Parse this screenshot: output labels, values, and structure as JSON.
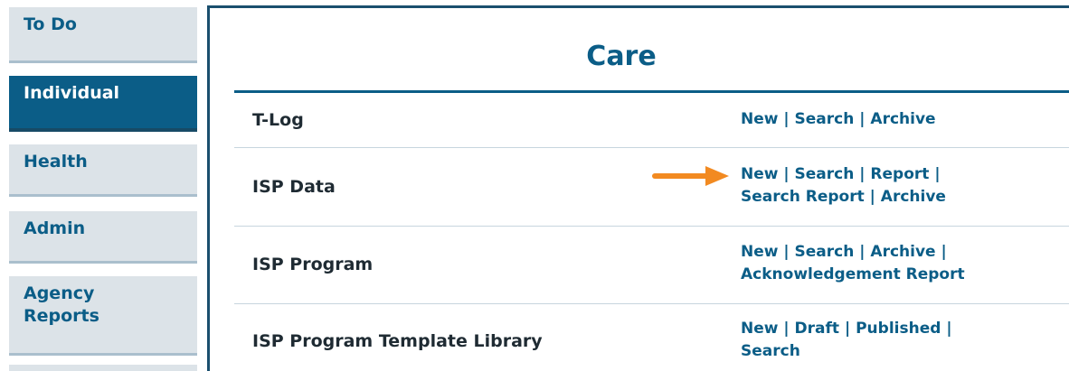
{
  "sidebar": {
    "items": [
      {
        "label": "To Do"
      },
      {
        "label": "Individual",
        "active": true
      },
      {
        "label": "Health"
      },
      {
        "label": "Admin"
      },
      {
        "label": "Agency Reports"
      }
    ]
  },
  "page": {
    "title": "Care"
  },
  "rows": [
    {
      "label": "T-Log",
      "links": [
        "New",
        "Search",
        "Archive"
      ]
    },
    {
      "label": "ISP Data",
      "links": [
        "New",
        "Search",
        "Report",
        "Search Report",
        "Archive"
      ]
    },
    {
      "label": "ISP Program",
      "links": [
        "New",
        "Search",
        "Archive",
        "Acknowledgement Report"
      ]
    },
    {
      "label": "ISP Program Template Library",
      "links": [
        "New",
        "Draft",
        "Published",
        "Search"
      ]
    }
  ],
  "annotation": {
    "arrow_color": "#f28a21",
    "icon": "right-arrow-icon"
  },
  "colors": {
    "brand": "#0b5d87",
    "tab_bg": "#dce3e8",
    "text": "#1f2b33"
  }
}
